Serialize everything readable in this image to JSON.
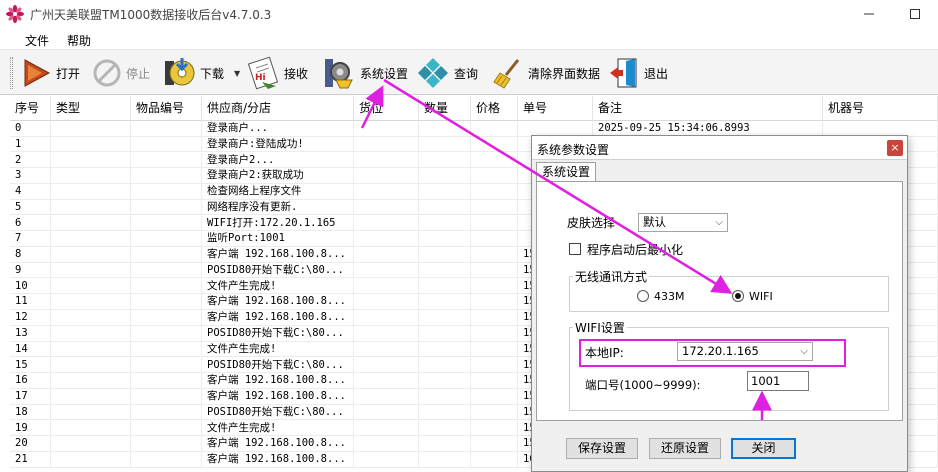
{
  "window": {
    "title": "广州天美联盟TM1000数据接收后台v4.7.0.3"
  },
  "menu": [
    "文件",
    "帮助"
  ],
  "toolbar": {
    "open": "打开",
    "stop": "停止",
    "download": "下载",
    "receive": "接收",
    "settings": "系统设置",
    "query": "查询",
    "clear": "清除界面数据",
    "exit": "退出"
  },
  "grid": {
    "columns": [
      "序号",
      "类型",
      "物品编号",
      "供应商/分店",
      "货位",
      "数量",
      "价格",
      "单号",
      "备注",
      "机器号"
    ],
    "rows": [
      {
        "n": "0",
        "supplier": "登录商户...",
        "order": "",
        "note": "2025-09-25 15:34:06.8993"
      },
      {
        "n": "1",
        "supplier": "登录商户:登陆成功!",
        "order": "",
        "note": ""
      },
      {
        "n": "2",
        "supplier": "登录商户2...",
        "order": "",
        "note": ""
      },
      {
        "n": "3",
        "supplier": "登录商户2:获取成功",
        "order": "",
        "note": ""
      },
      {
        "n": "4",
        "supplier": "检查网络上程序文件",
        "order": "",
        "note": ""
      },
      {
        "n": "5",
        "supplier": "网络程序没有更新.",
        "order": "",
        "note": ""
      },
      {
        "n": "6",
        "supplier": "WIFI打开:172.20.1.165",
        "order": "",
        "note": ""
      },
      {
        "n": "7",
        "supplier": "监听Port:1001",
        "order": "",
        "note": ""
      },
      {
        "n": "8",
        "supplier": "客户端 192.168.100.8...",
        "order": "15",
        "note": ""
      },
      {
        "n": "9",
        "supplier": "POSID80开始下载C:\\80...",
        "order": "15",
        "note": ""
      },
      {
        "n": "10",
        "supplier": "文件产生完成!",
        "order": "15",
        "note": ""
      },
      {
        "n": "11",
        "supplier": "客户端 192.168.100.8...",
        "order": "15",
        "note": ""
      },
      {
        "n": "12",
        "supplier": "客户端 192.168.100.8...",
        "order": "15",
        "note": ""
      },
      {
        "n": "13",
        "supplier": "POSID80开始下载C:\\80...",
        "order": "15",
        "note": ""
      },
      {
        "n": "14",
        "supplier": "文件产生完成!",
        "order": "15",
        "note": ""
      },
      {
        "n": "15",
        "supplier": "POSID80开始下载C:\\80...",
        "order": "15",
        "note": ""
      },
      {
        "n": "16",
        "supplier": "客户端 192.168.100.8...",
        "order": "15",
        "note": ""
      },
      {
        "n": "17",
        "supplier": "客户端 192.168.100.8...",
        "order": "15",
        "note": ""
      },
      {
        "n": "18",
        "supplier": "POSID80开始下载C:\\80...",
        "order": "15",
        "note": ""
      },
      {
        "n": "19",
        "supplier": "文件产生完成!",
        "order": "15",
        "note": ""
      },
      {
        "n": "20",
        "supplier": "客户端 192.168.100.8...",
        "order": "15",
        "note": ""
      },
      {
        "n": "21",
        "supplier": "客户端 192.168.100.8...",
        "order": "16",
        "note": ""
      }
    ]
  },
  "dialog": {
    "title": "系统参数设置",
    "close": "×",
    "tab": "系统设置",
    "skin_label": "皮肤选择",
    "skin_value": "默认",
    "minimize_label": "程序启动后最小化",
    "wireless_group": "无线通讯方式",
    "radio_433": "433M",
    "radio_wifi": "WIFI",
    "wifi_group": "WIFI设置",
    "ip_label": "本地IP:",
    "ip_value": "172.20.1.165",
    "port_label": "端口号(1000~9999):",
    "port_value": "1001",
    "save": "保存设置",
    "restore": "还原设置",
    "close_btn": "关闭"
  },
  "colors": {
    "highlight": "#e020e0"
  }
}
